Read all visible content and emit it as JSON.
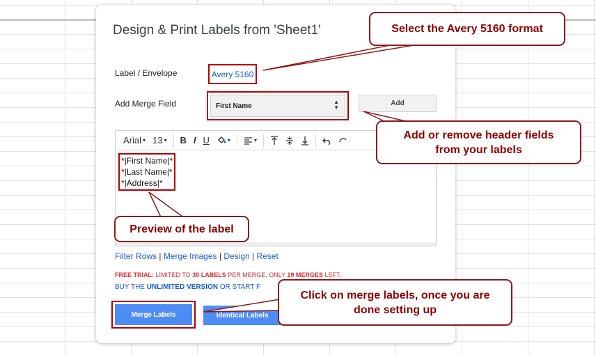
{
  "dialog": {
    "title": "Design & Print Labels from 'Sheet1'",
    "label_envelope_label": "Label / Envelope",
    "label_envelope_value": "Avery 5160",
    "merge_field_label": "Add Merge Field",
    "merge_field_selected": "First Name",
    "add_button": "Add"
  },
  "toolbar": {
    "font": "Arial",
    "size": "13",
    "bold": "B",
    "italic": "I",
    "underline": "U"
  },
  "editor_lines": [
    "*|First Name|*",
    "*|Last Name|*",
    "*|Address|*"
  ],
  "links": {
    "filter_rows": "Filter Rows",
    "merge_images": "Merge Images",
    "design": "Design",
    "reset": "Reset",
    "separator": " | "
  },
  "trial": {
    "prefix": "FREE TRIAL:",
    "limited_to": " LIMITED TO ",
    "labels_count": "30 LABELS",
    "per_merge": " PER MERGE, ONLY ",
    "merges_count": "19 MERGES",
    "left": " LEFT."
  },
  "buy": {
    "text1": "BUY THE ",
    "unlimited": "UNLIMITED VERSION",
    "text2": " OR START F"
  },
  "buttons": {
    "merge_labels": "Merge Labels",
    "identical_labels": "Identical Labels"
  },
  "callouts": {
    "avery": "Select the Avery 5160 format",
    "header_fields_1": "Add or remove header fields",
    "header_fields_2": "from your labels",
    "preview": "Preview of the label",
    "merge_1": "Click on merge labels, once you are",
    "merge_2": "done setting up"
  }
}
